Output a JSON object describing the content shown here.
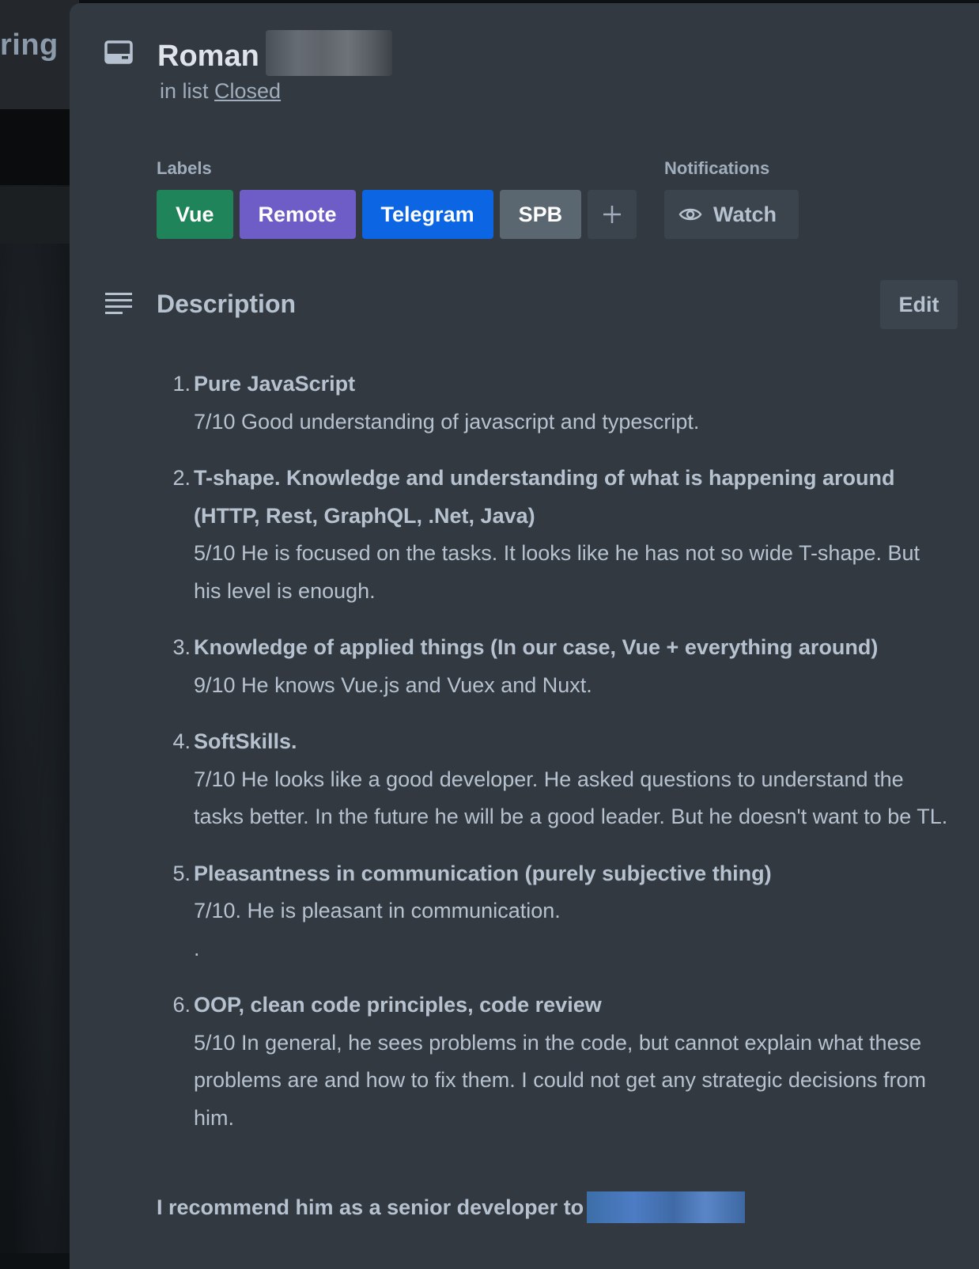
{
  "board": {
    "title_fragment": "ring"
  },
  "card": {
    "title": "Roman",
    "in_list_prefix": "in list",
    "list_name": "Closed"
  },
  "labels": {
    "heading": "Labels",
    "items": [
      {
        "text": "Vue",
        "color": "#1f845a"
      },
      {
        "text": "Remote",
        "color": "#6e5dc6"
      },
      {
        "text": "Telegram",
        "color": "#0c66e4"
      },
      {
        "text": "SPB",
        "color": "#5a6670"
      }
    ]
  },
  "notifications": {
    "heading": "Notifications",
    "watch_label": "Watch"
  },
  "description": {
    "heading": "Description",
    "edit_label": "Edit",
    "items": [
      {
        "num": "1.",
        "head": "Pure JavaScript",
        "body": "7/10 Good understanding of javascript and typescript."
      },
      {
        "num": "2.",
        "head": "T-shape. Knowledge and understanding of what is happening around (HTTP, Rest, GraphQL, .Net, Java)",
        "body": "5/10 He is focused on the tasks. It looks like he has not so wide T-shape. But his level is enough."
      },
      {
        "num": "3.",
        "head": "Knowledge of applied things (In our case, Vue + everything around)",
        "body": "9/10 He knows Vue.js and Vuex and Nuxt."
      },
      {
        "num": "4.",
        "head": "SoftSkills.",
        "body": "7/10 He looks like a good developer. He asked questions to understand the tasks better. In the future he will be a good leader. But he doesn't want to be TL."
      },
      {
        "num": "5.",
        "head": "Pleasantness in communication (purely subjective thing)",
        "body": "7/10. He is pleasant in communication.",
        "extra": "."
      },
      {
        "num": "6.",
        "head": "OOP, clean code principles, code review",
        "body": "5/10 In general, he sees problems in the code, but cannot explain what these problems are and how to fix them. I could not get any strategic decisions from him."
      }
    ],
    "recommendation": "I recommend him as a senior developer to"
  }
}
